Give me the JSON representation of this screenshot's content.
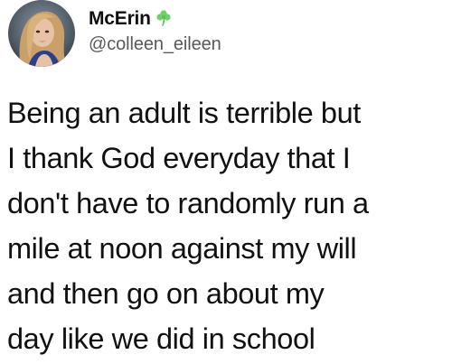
{
  "author": {
    "display_name": "McErin",
    "badge_icon": "shamrock-icon",
    "badge_color": "#6fcf6a",
    "handle": "@colleen_eileen"
  },
  "tweet": {
    "lines": [
      "Being an adult is terrible but",
      "I thank God everyday that I",
      "don't have to randomly run a",
      "mile at noon against my will",
      "and then go on about my",
      "day like we did in school"
    ]
  }
}
